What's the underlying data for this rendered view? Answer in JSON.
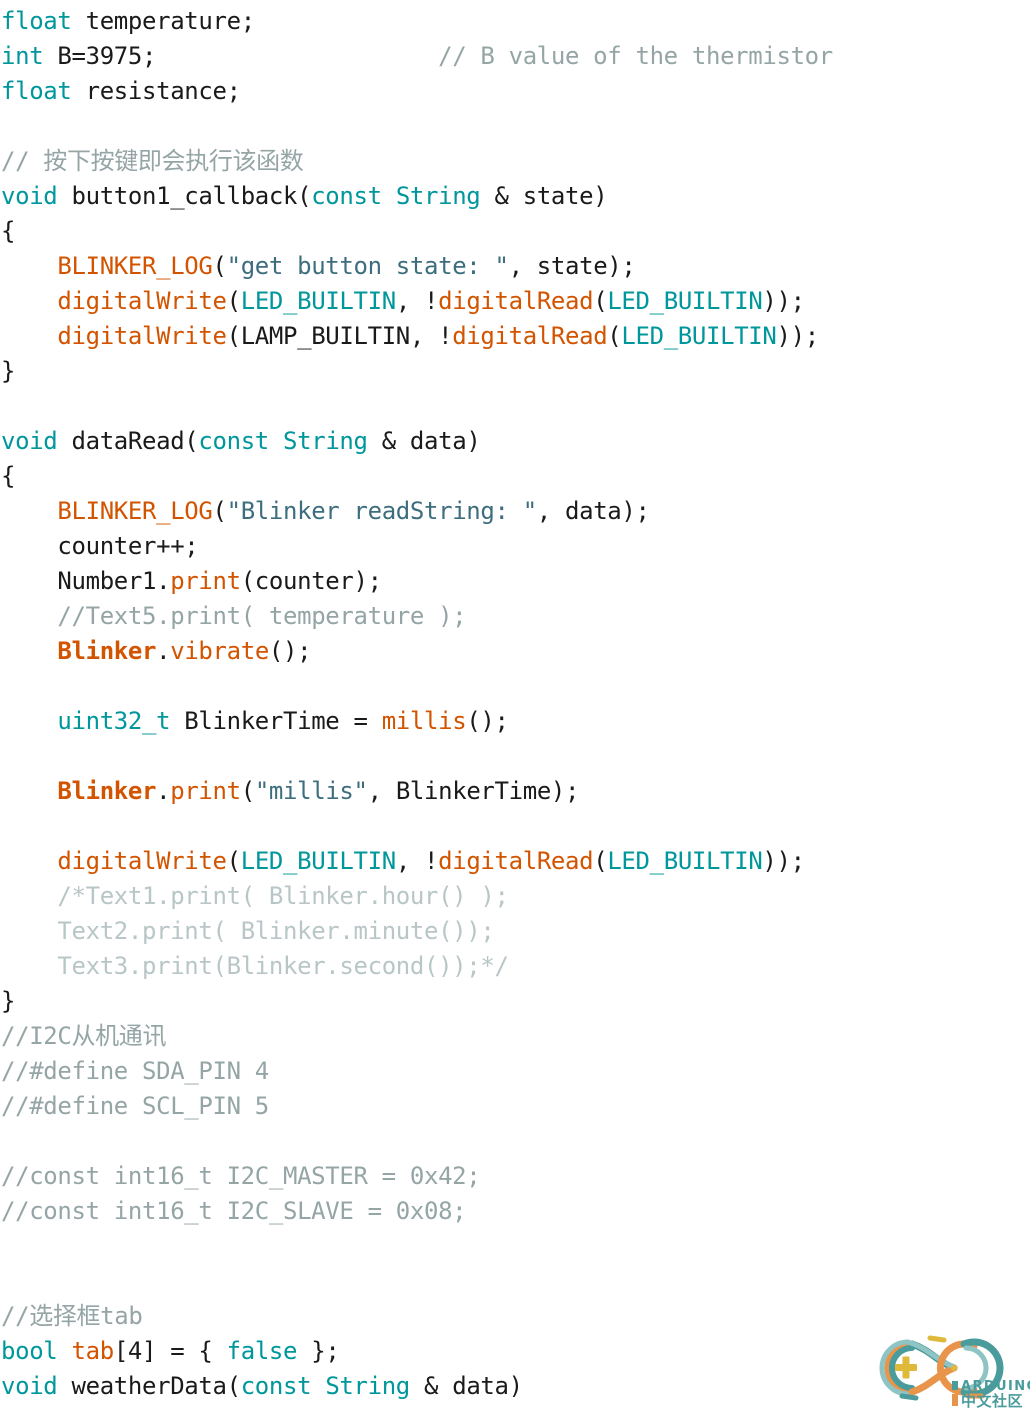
{
  "editor": {
    "language": "arduino-cpp",
    "background_color": "#ffffff",
    "colors": {
      "keyword": "#00979c",
      "function": "#d35400",
      "object": "#d35400",
      "string": "#3d6e7e",
      "comment": "#95a5a6",
      "block_comment": "#b9c6c7",
      "plain": "#1a1a1a"
    },
    "lines": [
      [
        {
          "t": "float",
          "c": "keyword"
        },
        {
          "t": " temperature;",
          "c": "plain"
        }
      ],
      [
        {
          "t": "int",
          "c": "keyword"
        },
        {
          "t": " B=3975;                    ",
          "c": "plain"
        },
        {
          "t": "// B value of the thermistor",
          "c": "comment"
        }
      ],
      [
        {
          "t": "float",
          "c": "keyword"
        },
        {
          "t": " resistance;",
          "c": "plain"
        }
      ],
      [],
      [
        {
          "t": "// 按下按键即会执行该函数",
          "c": "comment"
        }
      ],
      [
        {
          "t": "void",
          "c": "keyword"
        },
        {
          "t": " button1_callback(",
          "c": "plain"
        },
        {
          "t": "const",
          "c": "keyword"
        },
        {
          "t": " ",
          "c": "plain"
        },
        {
          "t": "String",
          "c": "type"
        },
        {
          "t": " & state)",
          "c": "plain"
        }
      ],
      [
        {
          "t": "{",
          "c": "plain"
        }
      ],
      [
        {
          "t": "    ",
          "c": "plain"
        },
        {
          "t": "BLINKER_LOG",
          "c": "func"
        },
        {
          "t": "(",
          "c": "plain"
        },
        {
          "t": "\"get button state: \"",
          "c": "string"
        },
        {
          "t": ", state);",
          "c": "plain"
        }
      ],
      [
        {
          "t": "    ",
          "c": "plain"
        },
        {
          "t": "digitalWrite",
          "c": "func"
        },
        {
          "t": "(",
          "c": "plain"
        },
        {
          "t": "LED_BUILTIN",
          "c": "const"
        },
        {
          "t": ", !",
          "c": "plain"
        },
        {
          "t": "digitalRead",
          "c": "func"
        },
        {
          "t": "(",
          "c": "plain"
        },
        {
          "t": "LED_BUILTIN",
          "c": "const"
        },
        {
          "t": "));",
          "c": "plain"
        }
      ],
      [
        {
          "t": "    ",
          "c": "plain"
        },
        {
          "t": "digitalWrite",
          "c": "func"
        },
        {
          "t": "(LAMP_BUILTIN, !",
          "c": "plain"
        },
        {
          "t": "digitalRead",
          "c": "func"
        },
        {
          "t": "(",
          "c": "plain"
        },
        {
          "t": "LED_BUILTIN",
          "c": "const"
        },
        {
          "t": "));",
          "c": "plain"
        }
      ],
      [
        {
          "t": "}",
          "c": "plain"
        }
      ],
      [],
      [
        {
          "t": "void",
          "c": "keyword"
        },
        {
          "t": " dataRead(",
          "c": "plain"
        },
        {
          "t": "const",
          "c": "keyword"
        },
        {
          "t": " ",
          "c": "plain"
        },
        {
          "t": "String",
          "c": "type"
        },
        {
          "t": " & data)",
          "c": "plain"
        }
      ],
      [
        {
          "t": "{",
          "c": "plain"
        }
      ],
      [
        {
          "t": "    ",
          "c": "plain"
        },
        {
          "t": "BLINKER_LOG",
          "c": "func"
        },
        {
          "t": "(",
          "c": "plain"
        },
        {
          "t": "\"Blinker readString: \"",
          "c": "string"
        },
        {
          "t": ", data);",
          "c": "plain"
        }
      ],
      [
        {
          "t": "    counter++;",
          "c": "plain"
        }
      ],
      [
        {
          "t": "    Number1.",
          "c": "plain"
        },
        {
          "t": "print",
          "c": "func"
        },
        {
          "t": "(counter);",
          "c": "plain"
        }
      ],
      [
        {
          "t": "    ",
          "c": "plain"
        },
        {
          "t": "//Text5.print( temperature );",
          "c": "comment"
        }
      ],
      [
        {
          "t": "    ",
          "c": "plain"
        },
        {
          "t": "Blinker",
          "c": "obj"
        },
        {
          "t": ".",
          "c": "plain"
        },
        {
          "t": "vibrate",
          "c": "func"
        },
        {
          "t": "();",
          "c": "plain"
        }
      ],
      [],
      [
        {
          "t": "    ",
          "c": "plain"
        },
        {
          "t": "uint32_t",
          "c": "type"
        },
        {
          "t": " BlinkerTime = ",
          "c": "plain"
        },
        {
          "t": "millis",
          "c": "func"
        },
        {
          "t": "();",
          "c": "plain"
        }
      ],
      [],
      [
        {
          "t": "    ",
          "c": "plain"
        },
        {
          "t": "Blinker",
          "c": "obj"
        },
        {
          "t": ".",
          "c": "plain"
        },
        {
          "t": "print",
          "c": "func"
        },
        {
          "t": "(",
          "c": "plain"
        },
        {
          "t": "\"millis\"",
          "c": "string"
        },
        {
          "t": ", BlinkerTime);",
          "c": "plain"
        }
      ],
      [],
      [
        {
          "t": "    ",
          "c": "plain"
        },
        {
          "t": "digitalWrite",
          "c": "func"
        },
        {
          "t": "(",
          "c": "plain"
        },
        {
          "t": "LED_BUILTIN",
          "c": "const"
        },
        {
          "t": ", !",
          "c": "plain"
        },
        {
          "t": "digitalRead",
          "c": "func"
        },
        {
          "t": "(",
          "c": "plain"
        },
        {
          "t": "LED_BUILTIN",
          "c": "const"
        },
        {
          "t": "));",
          "c": "plain"
        }
      ],
      [
        {
          "t": "    ",
          "c": "plain"
        },
        {
          "t": "/*Text1.print( Blinker.hour() );",
          "c": "block_comment"
        }
      ],
      [
        {
          "t": "    ",
          "c": "plain"
        },
        {
          "t": "Text2.print( Blinker.minute());",
          "c": "block_comment"
        }
      ],
      [
        {
          "t": "    ",
          "c": "plain"
        },
        {
          "t": "Text3.print(Blinker.second());*/",
          "c": "block_comment"
        }
      ],
      [
        {
          "t": "}",
          "c": "plain"
        }
      ],
      [
        {
          "t": "//I2C从机通讯",
          "c": "comment"
        }
      ],
      [
        {
          "t": "//#define SDA_PIN 4",
          "c": "comment"
        }
      ],
      [
        {
          "t": "//#define SCL_PIN 5",
          "c": "comment"
        }
      ],
      [],
      [
        {
          "t": "//const int16_t I2C_MASTER = 0x42;",
          "c": "comment"
        }
      ],
      [
        {
          "t": "//const int16_t I2C_SLAVE = 0x08;",
          "c": "comment"
        }
      ],
      [],
      [],
      [
        {
          "t": "//选择框tab",
          "c": "comment"
        }
      ],
      [
        {
          "t": "bool",
          "c": "keyword"
        },
        {
          "t": " ",
          "c": "plain"
        },
        {
          "t": "tab",
          "c": "func"
        },
        {
          "t": "[4] = { ",
          "c": "plain"
        },
        {
          "t": "false",
          "c": "keyword"
        },
        {
          "t": " };",
          "c": "plain"
        }
      ],
      [
        {
          "t": "void",
          "c": "keyword"
        },
        {
          "t": " weatherData(",
          "c": "plain"
        },
        {
          "t": "const",
          "c": "keyword"
        },
        {
          "t": " ",
          "c": "plain"
        },
        {
          "t": "String",
          "c": "type"
        },
        {
          "t": " & data)",
          "c": "plain"
        }
      ]
    ]
  },
  "watermark": {
    "brand": "ARDUINO",
    "subtitle": "中文社区",
    "colors": {
      "teal": "#4a9b9b",
      "orange": "#e8944a",
      "yellow": "#dfb93a",
      "light_teal": "#8fc4c4"
    }
  }
}
